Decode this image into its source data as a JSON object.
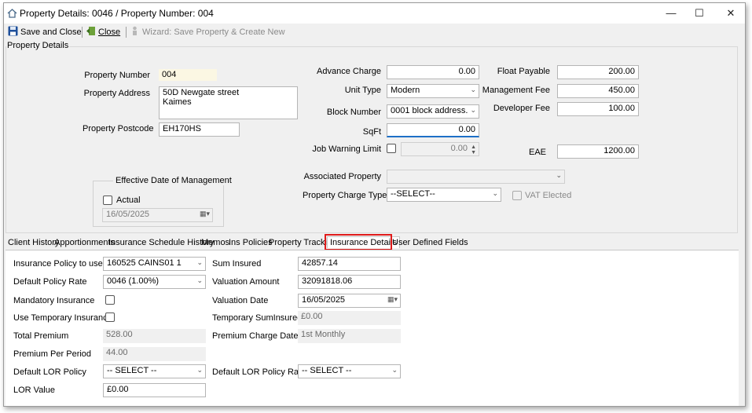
{
  "window": {
    "title": "Property Details: 0046  /  Property Number: 004",
    "minimize": "—",
    "maximize": "☐",
    "close": "✕"
  },
  "toolbar": {
    "save_close": "Save and Close",
    "close": "Close",
    "wizard": "Wizard: Save Property & Create New"
  },
  "group_label": "Property Details",
  "left": {
    "property_number_label": "Property Number",
    "property_number": "004",
    "property_address_label": "Property Address",
    "property_address": "50D Newgate street\nKaimes",
    "property_postcode_label": "Property Postcode",
    "property_postcode": "EH170HS"
  },
  "effective_date": {
    "title": "Effective Date of Management",
    "actual_label": "Actual",
    "date": "16/05/2025"
  },
  "middle": {
    "advance_charge_label": "Advance Charge",
    "advance_charge": "0.00",
    "unit_type_label": "Unit Type",
    "unit_type": "Modern",
    "block_number_label": "Block Number",
    "block_number": "0001  block address.",
    "sqft_label": "SqFt",
    "sqft": "0.00",
    "job_warning_limit_label": "Job Warning Limit",
    "job_warning_limit": "0.00",
    "associated_property_label": "Associated Property",
    "associated_property": "",
    "property_charge_type_label": "Property Charge Type",
    "property_charge_type": "--SELECT--",
    "vat_elected_label": "VAT Elected"
  },
  "right": {
    "float_payable_label": "Float Payable",
    "float_payable": "200.00",
    "management_fee_label": "Management Fee",
    "management_fee": "450.00",
    "developer_fee_label": "Developer Fee",
    "developer_fee": "100.00",
    "eae_label": "EAE",
    "eae": "1200.00"
  },
  "tabs": [
    "Client History",
    "Apportionments",
    "Insurance Schedule History",
    "Memos",
    "Ins Policies",
    "Property Tracking",
    "Insurance Details",
    "User Defined Fields"
  ],
  "active_tab": "Insurance Details",
  "insurance": {
    "policy_to_use_label": "Insurance Policy to use",
    "policy_to_use": "160525 CAINS01 1",
    "default_policy_rate_label": "Default Policy Rate",
    "default_policy_rate": "0046 (1.00%)",
    "mandatory_insurance_label": "Mandatory Insurance",
    "use_temporary_insurance_label": "Use Temporary Insurance",
    "total_premium_label": "Total Premium",
    "total_premium": "528.00",
    "premium_per_period_label": "Premium Per Period",
    "premium_per_period": "44.00",
    "default_lor_policy_label": "Default LOR Policy",
    "default_lor_policy": "-- SELECT --",
    "lor_value_label": "LOR Value",
    "lor_value": "£0.00",
    "sum_insured_label": "Sum Insured",
    "sum_insured": "42857.14",
    "valuation_amount_label": "Valuation Amount",
    "valuation_amount": "32091818.06",
    "valuation_date_label": "Valuation Date",
    "valuation_date": "16/05/2025",
    "temporary_sum_insured_label": "Temporary SumInsured",
    "temporary_sum_insured": "£0.00",
    "premium_charge_date_label": "Premium Charge Date",
    "premium_charge_date": "1st Monthly",
    "default_lor_policy_rate_label": "Default LOR Policy Rate",
    "default_lor_policy_rate": "-- SELECT --"
  },
  "colors": {
    "highlight": "#e01b1b",
    "window_bg": "#f0f0f0",
    "panel_bg": "#ffffff"
  }
}
